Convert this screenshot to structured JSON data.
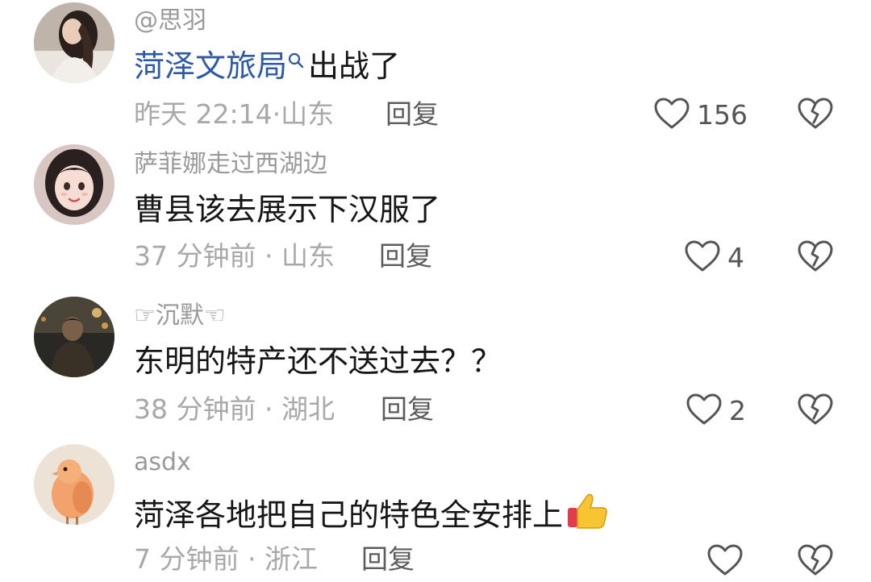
{
  "comments": [
    {
      "username": "@思羽",
      "mention": "菏泽文旅局",
      "text": "出战了",
      "time": "昨天 22:14",
      "sep": "·",
      "location": "山东",
      "reply_label": "回复",
      "likes": "156",
      "avatar": "avatar-woman-long-hair"
    },
    {
      "username": "萨菲娜走过西湖边",
      "text": "曹县该去展示下汉服了",
      "time": "37 分钟前",
      "sep": "·",
      "location": "山东",
      "reply_label": "回复",
      "likes": "4",
      "avatar": "avatar-anime-girl"
    },
    {
      "username": "☞沉默☜",
      "text": "东明的特产还不送过去？？",
      "time": "38 分钟前",
      "sep": "·",
      "location": "湖北",
      "reply_label": "回复",
      "likes": "2",
      "avatar": "avatar-man-night"
    },
    {
      "username": "asdx",
      "text": "菏泽各地把自己的特色全安排上",
      "emoji": "thumbs-up",
      "time": "7 分钟前",
      "sep": "·",
      "location": "浙江",
      "reply_label": "回复",
      "likes": "",
      "avatar": "avatar-bird"
    }
  ],
  "colors": {
    "username": "#9a9a9a",
    "content": "#161616",
    "mention": "#2c5aa8",
    "meta": "#a8a8a8",
    "reply": "#5c5c5c",
    "icon": "#555555"
  },
  "icons": {
    "like": "heart-outline-icon",
    "dislike": "broken-heart-icon",
    "mention_search": "search-icon"
  }
}
